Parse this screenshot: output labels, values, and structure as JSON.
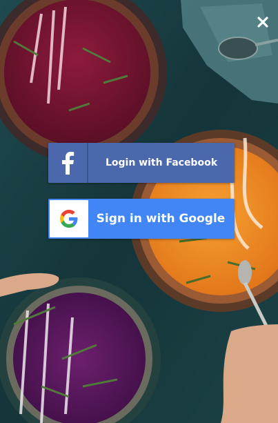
{
  "modal": {
    "close_icon": "close-icon",
    "facebook_button": {
      "label": "Login with Facebook",
      "icon": "facebook-icon",
      "color": "#4b68ad"
    },
    "google_button": {
      "label": "Sign in with Google",
      "icon": "google-icon",
      "color": "#4285f4"
    }
  },
  "background": {
    "description_icon": "food-photo-soup-bowls"
  }
}
